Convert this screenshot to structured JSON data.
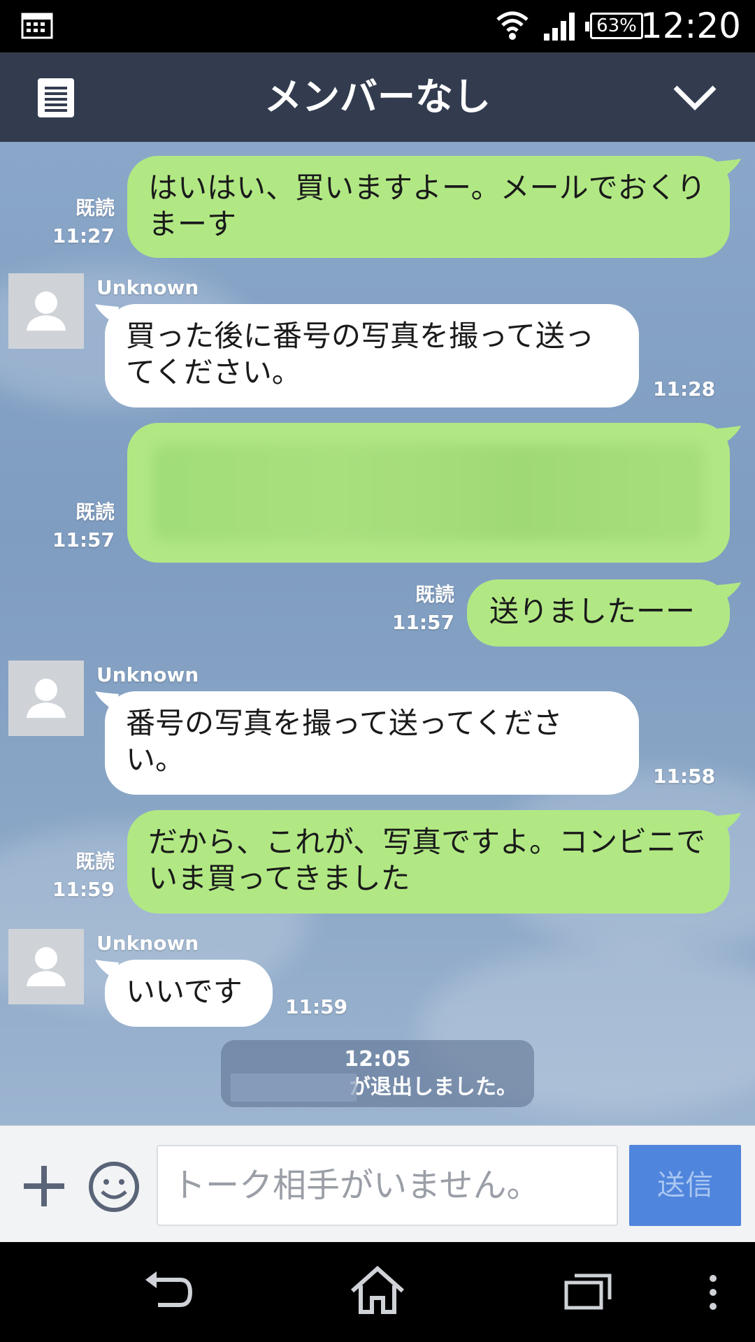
{
  "status_bar": {
    "battery": "63%",
    "time": "12:20"
  },
  "header": {
    "title": "メンバーなし"
  },
  "messages": [
    {
      "side": "me",
      "read": "既読",
      "time": "11:27",
      "text": "はいはい、買いますよー。メールでおくりまーす"
    },
    {
      "side": "them",
      "sender": "Unknown",
      "time": "11:28",
      "text": "買った後に番号の写真を撮って送ってください。"
    },
    {
      "side": "me",
      "read": "既読",
      "time": "11:57",
      "text": ""
    },
    {
      "side": "me",
      "read": "既読",
      "time": "11:57",
      "text": "送りましたーー"
    },
    {
      "side": "them",
      "sender": "Unknown",
      "time": "11:58",
      "text": "番号の写真を撮って送ってください。"
    },
    {
      "side": "me",
      "read": "既読",
      "time": "11:59",
      "text": "だから、これが、写真ですよ。コンビニでいま買ってきました"
    },
    {
      "side": "them",
      "sender": "Unknown",
      "time": "11:59",
      "text": "いいです"
    }
  ],
  "system_notice": {
    "time": "12:05",
    "text": "が退出しました。"
  },
  "input": {
    "placeholder": "トーク相手がいません。",
    "send_label": "送信"
  },
  "colors": {
    "header": "#333c4f",
    "my_bubble": "#b1e884",
    "their_bubble": "#ffffff",
    "send_button": "#4f85dc"
  }
}
